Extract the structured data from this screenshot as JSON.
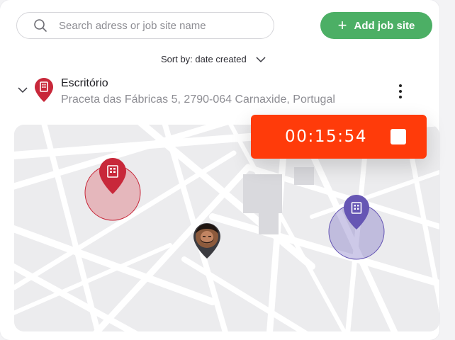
{
  "search": {
    "placeholder": "Search adress or job site name",
    "value": "",
    "icon": "search-icon"
  },
  "add_button": {
    "label": "Add job site",
    "icon": "plus-icon",
    "color": "#4caf65"
  },
  "sort": {
    "label": "Sort by: date created",
    "icon": "chevron-down-icon"
  },
  "job_site": {
    "name": "Escritório",
    "address": "Praceta das Fábricas 5, 2790-064 Carnaxide, Portugal",
    "pin_color": "#c8283a",
    "icons": [
      "chevron-down-icon",
      "building-pin-icon",
      "more-vertical-icon"
    ]
  },
  "timer": {
    "time": "00:15:54",
    "color": "#ff3b0a",
    "stop_icon": "stop-icon"
  },
  "map": {
    "markers": [
      {
        "name": "job-site-marker-red",
        "icon": "building-pin-icon",
        "color": "#c8283a"
      },
      {
        "name": "user-location-marker",
        "icon": "avatar"
      },
      {
        "name": "job-site-marker-purple",
        "icon": "building-pin-icon",
        "color": "#6656b4"
      }
    ]
  }
}
